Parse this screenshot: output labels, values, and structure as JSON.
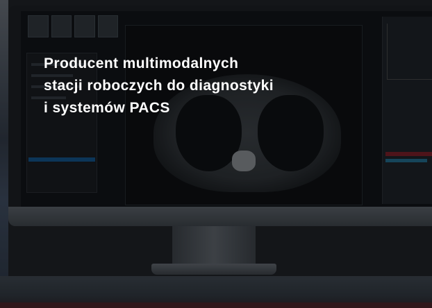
{
  "hero": {
    "headline_lines": [
      "Producent multimodalnych",
      "stacji roboczych do diagnostyki",
      "i systemów PACS"
    ]
  },
  "colors": {
    "headline_text": "#ffffff",
    "overlay": "#0a0c0e",
    "accent_bottom": "#4a1f25",
    "screen_blue": "#0f4f86",
    "screen_red": "#7a1a22"
  },
  "icons": [
    "monitor-illustration",
    "ct-scan-image"
  ]
}
